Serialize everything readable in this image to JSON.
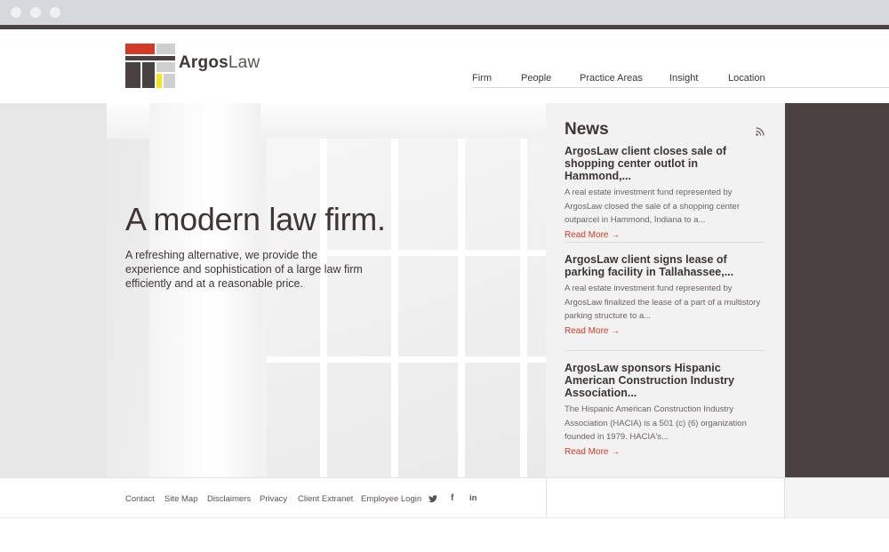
{
  "brand": {
    "name_bold": "Argos",
    "name_light": "Law"
  },
  "nav": {
    "items": [
      "Firm",
      "People",
      "Practice Areas",
      "Insight",
      "Location"
    ]
  },
  "hero": {
    "title": "A modern law firm.",
    "text": "A refreshing alternative, we provide the experience and sophistication of a large law firm efficiently and at a reasonable price."
  },
  "news": {
    "title": "News",
    "items": [
      {
        "headline": "ArgosLaw client closes sale of shopping center outlot in Hammond,...",
        "summary": "A real estate investment fund represented by ArgosLaw closed the sale of a shopping center outparcel in Hammond, Indiana to a...",
        "more": "Read More →"
      },
      {
        "headline": "ArgosLaw client signs lease of parking facility in Tallahassee,...",
        "summary": "A real estate investment fund represented by ArgosLaw finalized the lease of a part of a multistory parking structure to a...",
        "more": "Read More →"
      },
      {
        "headline": "ArgosLaw sponsors Hispanic American Construction Industry Association...",
        "summary": "The Hispanic American Construction Industry Association (HACIA) is a 501 (c) (6) organization founded in 1979.  HACIA's...",
        "more": "Read More →"
      }
    ]
  },
  "footer": {
    "links": [
      "Contact",
      "Site Map",
      "Disclaimers",
      "Privacy",
      "Client Extranet",
      "Employee Login"
    ],
    "social": [
      "twitter-icon",
      "facebook-icon",
      "linkedin-icon"
    ]
  },
  "colors": {
    "accent": "#d33b26",
    "dark": "#4a4240",
    "text": "#3d3634",
    "logo_yellow": "#f2e31b"
  }
}
